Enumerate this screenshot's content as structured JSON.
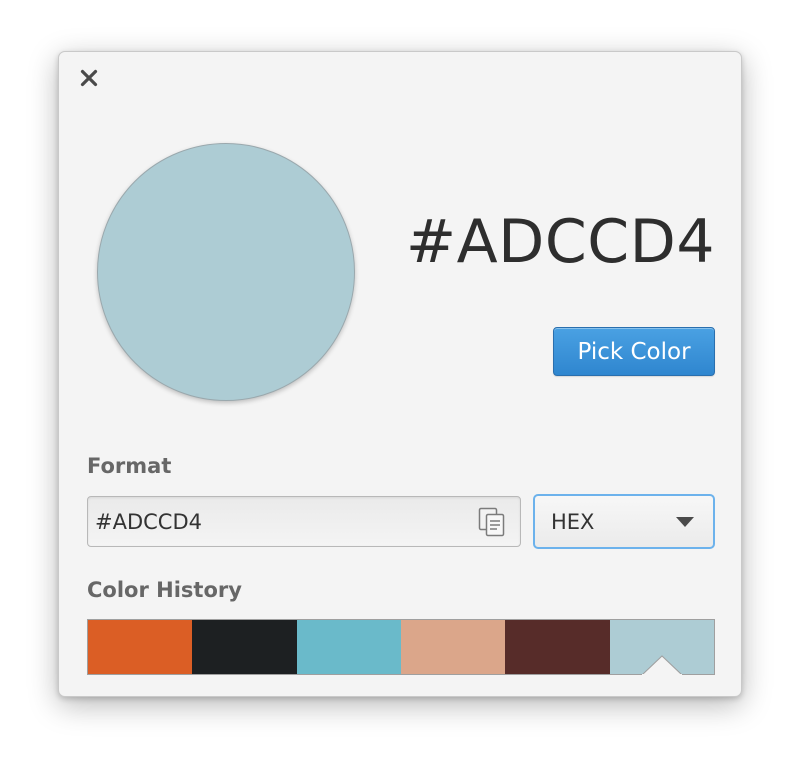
{
  "window": {
    "close_icon": "close-icon"
  },
  "current_color": {
    "hex": "#ADCCD4",
    "swatch_color": "#ADCCD4"
  },
  "pick_button": {
    "label": "Pick Color",
    "color": "#3a94db"
  },
  "format": {
    "label": "Format",
    "value": "#ADCCD4",
    "copy_icon": "copy-icon",
    "selected_format": "HEX",
    "dropdown_icon": "chevron-down-icon"
  },
  "history": {
    "label": "Color History",
    "swatches": [
      {
        "color": "#DB5E25",
        "selected": false
      },
      {
        "color": "#1D2022",
        "selected": false
      },
      {
        "color": "#6ABACA",
        "selected": false
      },
      {
        "color": "#DBA68A",
        "selected": false
      },
      {
        "color": "#572C29",
        "selected": false
      },
      {
        "color": "#ADCCD4",
        "selected": true
      }
    ]
  }
}
